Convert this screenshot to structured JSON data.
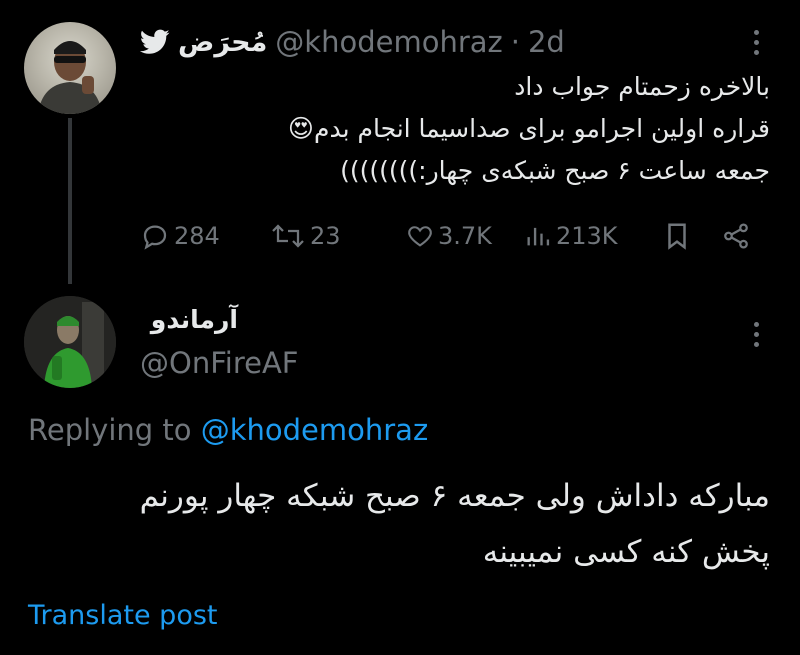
{
  "tweet": {
    "display_name": "مُحرَض",
    "handle": "@khodemohraz",
    "separator": "·",
    "time": "2d",
    "lines": [
      "بالاخره زحمتام جواب داد",
      "قراره اولین اجرامو برای صداسیما انجام بدم😍",
      "جمعه ساعت ۶ صبح شبکه‌ی چهار:))))))))"
    ],
    "stats": {
      "replies": "284",
      "reposts": "23",
      "likes": "3.7K",
      "views": "213K"
    },
    "icons": {
      "platform": "twitter-bird-icon",
      "reply": "reply-icon",
      "repost": "repost-icon",
      "like": "heart-icon",
      "views": "views-icon",
      "bookmark": "bookmark-icon",
      "share": "share-icon",
      "more": "more-icon"
    }
  },
  "reply": {
    "display_name": "آرماندو",
    "handle": "@OnFireAF",
    "replying_prefix": "Replying to",
    "replying_to": "@khodemohraz",
    "lines": [
      "مبارکه داداش ولی جمعه ۶ صبح شبکه چهار پورنم",
      "پخش کنه کسی نمیبینه"
    ],
    "translate_label": "Translate post"
  },
  "colors": {
    "background": "#000000",
    "text": "#e7e9ea",
    "muted": "#71767b",
    "accent": "#1d9bf0"
  }
}
